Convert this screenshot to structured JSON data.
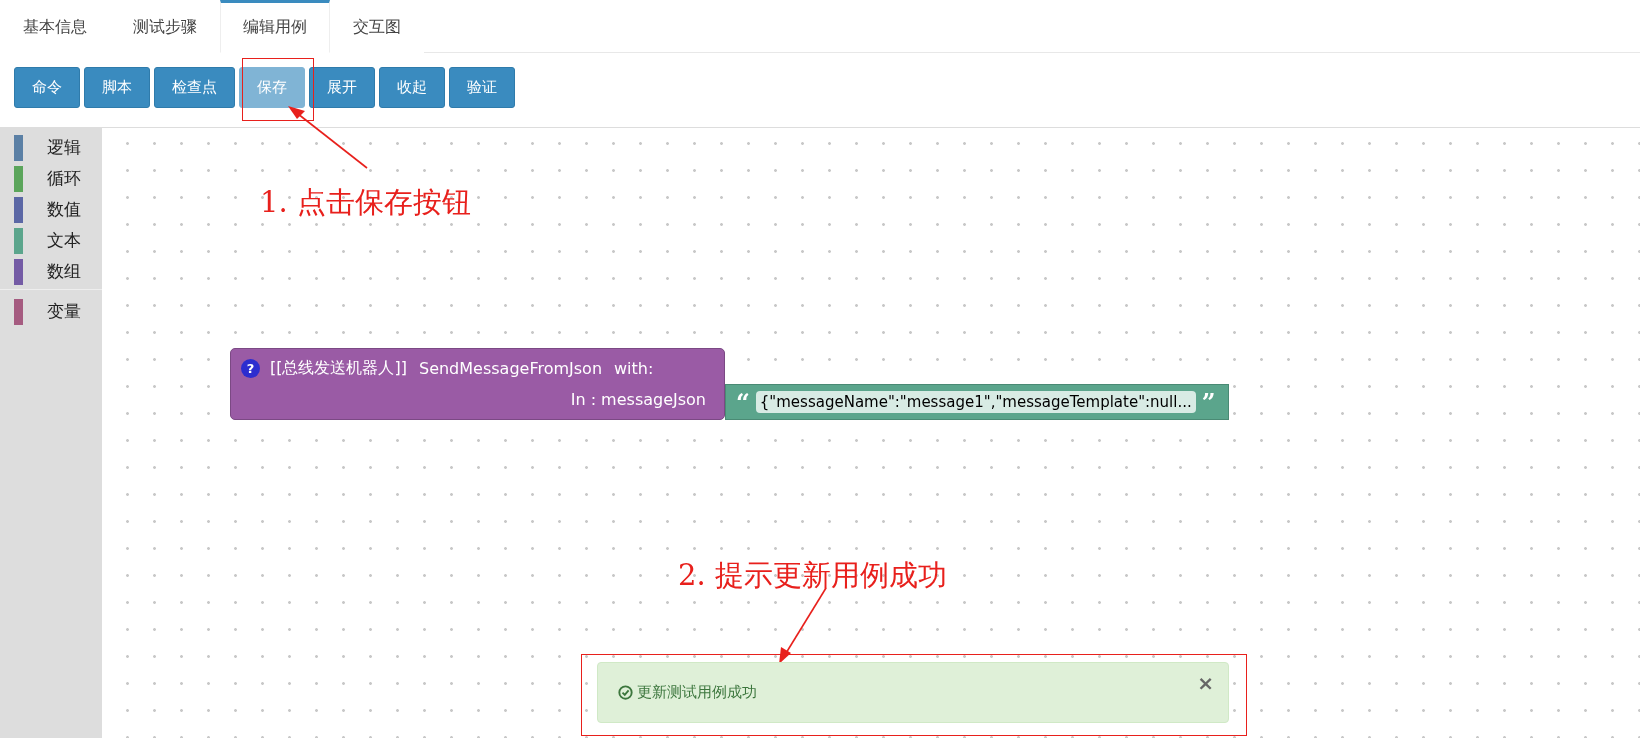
{
  "tabs": [
    {
      "label": "基本信息",
      "selected": false
    },
    {
      "label": "测试步骤",
      "selected": false
    },
    {
      "label": "编辑用例",
      "selected": true
    },
    {
      "label": "交互图",
      "selected": false
    }
  ],
  "toolbar": [
    {
      "label": "命令",
      "disabled": false
    },
    {
      "label": "脚本",
      "disabled": false
    },
    {
      "label": "检查点",
      "disabled": false
    },
    {
      "label": "保存",
      "disabled": true
    },
    {
      "label": "展开",
      "disabled": false
    },
    {
      "label": "收起",
      "disabled": false
    },
    {
      "label": "验证",
      "disabled": false
    }
  ],
  "toolbox": {
    "groups": [
      [
        {
          "label": "逻辑",
          "color": "#5b80a5"
        },
        {
          "label": "循环",
          "color": "#5ba55b"
        },
        {
          "label": "数值",
          "color": "#5b67a5"
        },
        {
          "label": "文本",
          "color": "#5ba58c"
        },
        {
          "label": "数组",
          "color": "#745ba5"
        }
      ],
      [
        {
          "label": "变量",
          "color": "#a55b80"
        }
      ]
    ]
  },
  "block": {
    "help": "?",
    "robot": "[[总线发送机器人]]",
    "method": "SendMessageFromJson",
    "with": "with:",
    "input_label": "In : messageJson",
    "open_quote": "“",
    "value": "{\"messageName\":\"message1\",\"messageTemplate\":null...",
    "close_quote": "”"
  },
  "toast": {
    "message": "更新测试用例成功",
    "close": "×"
  },
  "annotations": [
    {
      "text": "1. 点击保存按钮"
    },
    {
      "text": "2. 提示更新用例成功"
    }
  ]
}
